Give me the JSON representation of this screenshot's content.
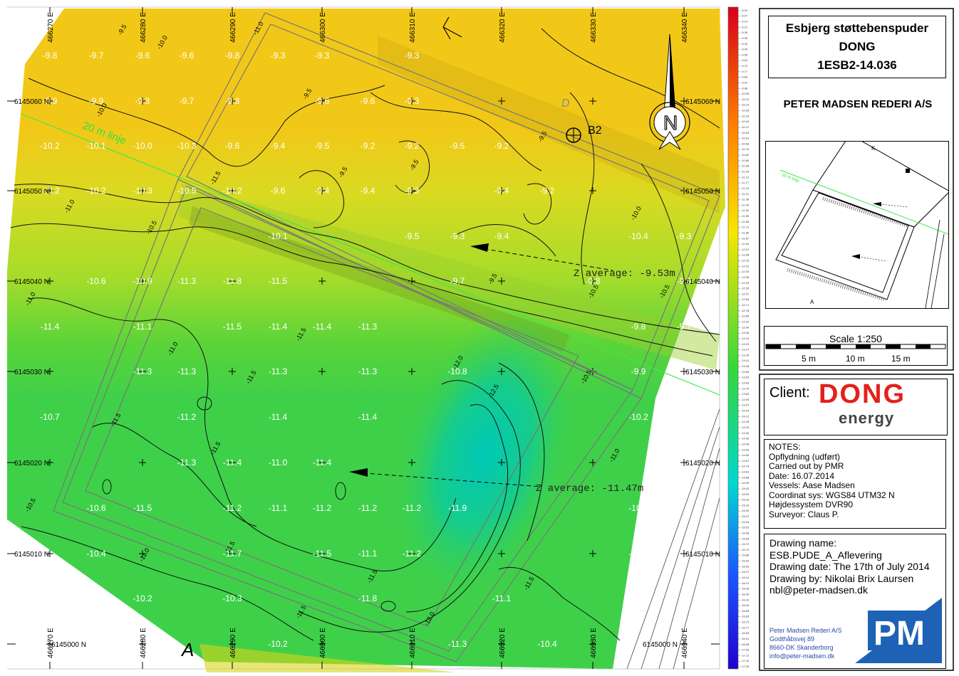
{
  "title": {
    "line1": "Esbjerg støttebenspuder",
    "line2": "DONG",
    "line3": "1ESB2-14.036"
  },
  "company": "PETER MADSEN REDERI A/S",
  "map": {
    "easting_labels": [
      "466270 E",
      "466280 E",
      "466290 E",
      "466300 E",
      "466310 E",
      "466320 E",
      "466330 E",
      "466340 E"
    ],
    "easting_bottom_labels": [
      "466270 E",
      "466280 E",
      "466290 E",
      "466300 E",
      "466310 E",
      "466320 E",
      "466330 E",
      "466340 E"
    ],
    "northing_left_labels": [
      "6145060 N",
      "6145050 N",
      "6145040 N",
      "6145030 N",
      "6145020 N",
      "6145010 N",
      "6145000 N"
    ],
    "northing_right_labels": [
      "6145060 N",
      "6145050 N",
      "6145040 N",
      "6145030 N",
      "6145020 N",
      "6145010 N",
      "6145000 N"
    ],
    "depth_rows": [
      [
        "-9.8",
        "-9.7",
        "-9.6",
        "-9.6",
        "-9.8",
        "-9.3",
        "-9.3",
        "-9.3"
      ],
      [
        "-9.9",
        "-9.9",
        "-9.8",
        "-9.7",
        "-9.8",
        "-9.6",
        "-9.6",
        "-9.3"
      ],
      [
        "-10.2",
        "-10.1",
        "-10.0",
        "-10.3",
        "-9.6",
        "-9.4",
        "-9.5",
        "-9.2",
        "-9.2",
        "-9.5",
        "-9.2"
      ],
      [
        "-10.2",
        "-10.2",
        "-10.3",
        "-10.5",
        "-10.2",
        "-9.6",
        "-9.4",
        "-9.4",
        "-9.3",
        "-9.4",
        "-9.2"
      ],
      [
        "-10.1",
        "-9.5",
        "-9.3",
        "-9.4",
        "-10.4",
        "-9.3"
      ],
      [
        "-10.6",
        "-10.9",
        "-11.3",
        "-11.8",
        "-11.5",
        "-9.7",
        "-9.8",
        "-9.9"
      ],
      [
        "-11.4",
        "-11.1",
        "-11.5",
        "-11.4",
        "-11.4",
        "-11.3",
        "-9.8",
        "-9.7"
      ],
      [
        "-11.3",
        "-11.3",
        "-11.3",
        "-11.3",
        "-10.8",
        "-9.9"
      ],
      [
        "-10.7",
        "-11.2",
        "-11.4",
        "-11.4",
        "-10.2"
      ],
      [
        "-11.3",
        "-11.4",
        "-11.0",
        "-11.4"
      ],
      [
        "-10.6",
        "-11.5",
        "-11.2",
        "-11.1",
        "-11.2",
        "-11.2",
        "-11.2",
        "-11.9",
        "-10.2"
      ],
      [
        "-10.4",
        "-11.7",
        "-11.5",
        "-11.1",
        "-11.2",
        "-11.4"
      ],
      [
        "-10.2",
        "-10.3",
        "-11.8",
        "-11.1"
      ],
      [
        "-10.2",
        "-11.3",
        "-10.4"
      ]
    ],
    "contour_labels": [
      "-9.5",
      "-10.0",
      "-10.5",
      "-11.0",
      "-11.5",
      "-12.0",
      "-12.5",
      "-9.0"
    ],
    "line_label": "20 m linje",
    "point_label": "B2",
    "corner_a": "A",
    "corner_d": "D",
    "north_letter": "N",
    "annotation_top": "Z average: -9.53m",
    "annotation_bottom": "Z average: -11.47m"
  },
  "legend": {
    "ticks": [
      "-9.00",
      "-9.07",
      "-9.14",
      "-9.21",
      "-9.28",
      "-9.35",
      "-9.42",
      "-9.49",
      "-9.56",
      "-9.63",
      "-9.70",
      "-9.77",
      "-9.84",
      "-9.91",
      "-9.98",
      "-10.05",
      "-10.12",
      "-10.19",
      "-10.26",
      "-10.33",
      "-10.40",
      "-10.47",
      "-10.54",
      "-10.61",
      "-10.68",
      "-10.75",
      "-10.82",
      "-10.89",
      "-10.96",
      "-11.03",
      "-11.10",
      "-11.17",
      "-11.24",
      "-11.31",
      "-11.38",
      "-11.45",
      "-11.52",
      "-11.59",
      "-11.66",
      "-11.73",
      "-11.80",
      "-11.87",
      "-11.94",
      "-12.01",
      "-12.08",
      "-12.15",
      "-12.22",
      "-12.29",
      "-12.36",
      "-12.43",
      "-12.50",
      "-12.57",
      "-12.64",
      "-12.71",
      "-12.78",
      "-12.85",
      "-12.92",
      "-12.99",
      "-13.06",
      "-13.13",
      "-13.20",
      "-13.27",
      "-13.34",
      "-13.41",
      "-13.48",
      "-13.55",
      "-13.62",
      "-13.69",
      "-13.76",
      "-13.83",
      "-13.90",
      "-13.97",
      "-14.04",
      "-14.11",
      "-14.18",
      "-14.25",
      "-14.32",
      "-14.39",
      "-14.46",
      "-14.53",
      "-14.60",
      "-14.67",
      "-14.74",
      "-14.81",
      "-14.88",
      "-14.95",
      "-15.02",
      "-15.09",
      "-15.16",
      "-15.23",
      "-15.30",
      "-15.37",
      "-15.44",
      "-15.51",
      "-15.58",
      "-15.65",
      "-15.72",
      "-15.79",
      "-15.86",
      "-15.93",
      "-16.00",
      "-16.07",
      "-16.14",
      "-16.21",
      "-16.28",
      "-16.35",
      "-16.42",
      "-16.49",
      "-16.56",
      "-16.63",
      "-16.70",
      "-16.77",
      "-16.84",
      "-16.91",
      "-16.98",
      "-17.05",
      "-17.12",
      "-17.19",
      "-17.26"
    ],
    "colors": [
      "#d7001a",
      "#ff8000",
      "#f7e600",
      "#34d63c",
      "#00d8d0",
      "#1a55ff",
      "#2200d0"
    ]
  },
  "inset": {
    "line_label": "20 m linje",
    "corner_a": "A",
    "corner_k": "K",
    "arrow_top": "Z average: -9.53m",
    "arrow_bottom": "Z average: -11.47m"
  },
  "scale": {
    "title": "Scale 1:250",
    "labels": [
      "5 m",
      "10 m",
      "15 m"
    ]
  },
  "client": {
    "label": "Client:",
    "logo_main": "DONG",
    "logo_sub": "energy"
  },
  "notes": {
    "lines": [
      "NOTES:",
      "Opflydning (udført)",
      "Carried out by PMR",
      "Date: 16.07.2014",
      "Vessels: Aase Madsen",
      "Coordinat sys: WGS84 UTM32 N",
      "Højdessystem DVR90",
      "Surveyor: Claus P."
    ]
  },
  "drawing": {
    "lines": [
      "Drawing name:",
      "ESB.PUDE_A_Aflevering",
      "Drawing date: The 17th of July 2014",
      "Drawing by: Nikolai Brix Laursen",
      "nbl@peter-madsen.dk"
    ]
  },
  "address": {
    "lines": [
      "Peter Madsen Rederi A/S",
      "Godthåbsvej 89",
      "8660-DK Skanderborg",
      "info@peter-madsen.dk"
    ],
    "logo_text": "PM"
  }
}
